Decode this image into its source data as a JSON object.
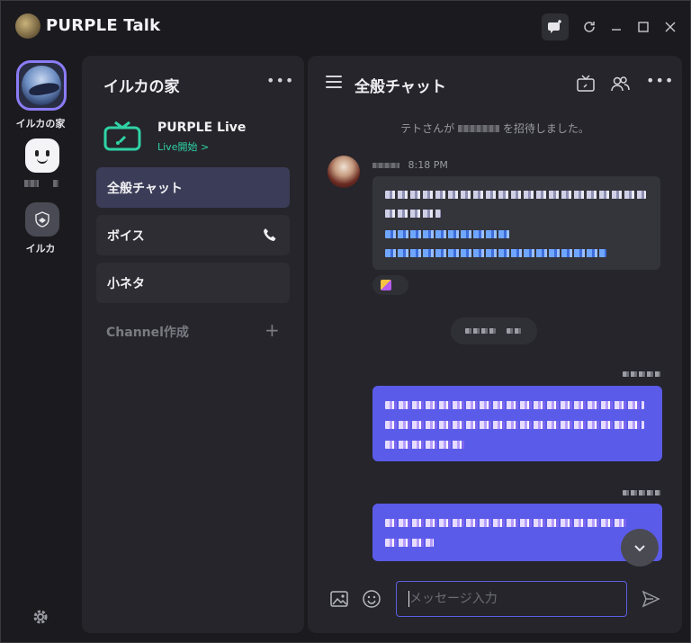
{
  "window": {
    "title": "PURPLE Talk",
    "controls": [
      "new-chat-icon",
      "refresh-icon",
      "minimize-icon",
      "maximize-icon",
      "close-icon"
    ]
  },
  "rail": {
    "servers": [
      {
        "label": "イルカの家",
        "active": true,
        "icon": "dolphin-avatar"
      },
      {
        "label": "",
        "icon": "smiley-face-avatar"
      },
      {
        "label": "イルカ",
        "icon": "shield-icon"
      }
    ]
  },
  "channels": {
    "server_name": "イルカの家",
    "live": {
      "title": "PURPLE Live",
      "subtitle": "Live開始 >"
    },
    "items": [
      {
        "label": "全般チャット",
        "active": true
      },
      {
        "label": "ボイス",
        "icon": "phone-icon"
      },
      {
        "label": "小ネタ"
      }
    ],
    "create_label": "Channel作成"
  },
  "chat": {
    "title": "全般チャット",
    "system_message_prefix": "テトさんが",
    "system_message_suffix": "を招待しました。",
    "message_time": "8:18 PM",
    "input_placeholder": "メッセージ入力"
  },
  "colors": {
    "accent": "#5b5bea",
    "live_green": "#2fd3a6",
    "active_ring": "#8b7cf6"
  }
}
